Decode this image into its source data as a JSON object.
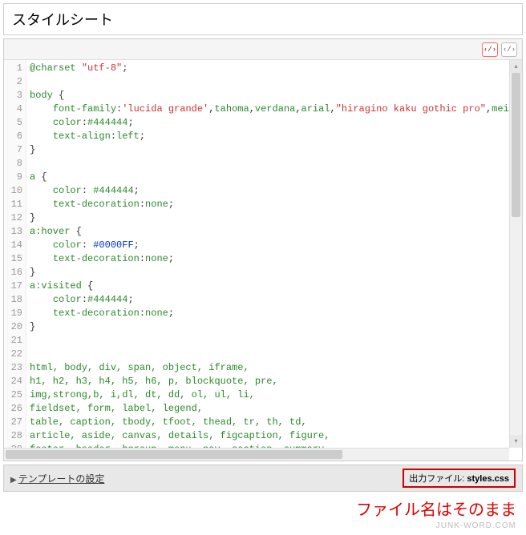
{
  "title": "スタイルシート",
  "toolbar": {
    "btn_wrap_active": "‹/›",
    "btn_wrap_inactive": "‹/›"
  },
  "code": {
    "lines": [
      {
        "n": 1,
        "html": "<span class='t-id'>@charset</span> <span class='t-str'>\"utf-8\"</span>;"
      },
      {
        "n": 2,
        "html": ""
      },
      {
        "n": 3,
        "html": "<span class='t-kw'>body</span> {"
      },
      {
        "n": 4,
        "html": "    <span class='t-prop'>font-family</span>:<span class='t-str'>'lucida grande'</span>,<span class='t-id'>tahoma</span>,<span class='t-id'>verdana</span>,<span class='t-id'>arial</span>,<span class='t-str'>\"hiragino kaku gothic pro\"</span>,<span class='t-id'>meiryo</span>,<span class='t-id'>Osaka</span>,<span class='t-str'>\"ms pgothic\"</span>,s"
      },
      {
        "n": 5,
        "html": "    <span class='t-prop'>color</span>:<span class='t-hex'>#444444</span>;"
      },
      {
        "n": 6,
        "html": "    <span class='t-prop'>text-align</span>:<span class='t-val'>left</span>;"
      },
      {
        "n": 7,
        "html": "}"
      },
      {
        "n": 8,
        "html": ""
      },
      {
        "n": 9,
        "html": "<span class='t-kw'>a</span> {"
      },
      {
        "n": 10,
        "html": "    <span class='t-prop'>color</span>: <span class='t-hex'>#444444</span>;"
      },
      {
        "n": 11,
        "html": "    <span class='t-prop'>text-decoration</span>:<span class='t-val'>none</span>;"
      },
      {
        "n": 12,
        "html": "}"
      },
      {
        "n": 13,
        "html": "<span class='t-kw'>a:hover</span> {"
      },
      {
        "n": 14,
        "html": "    <span class='t-prop'>color</span>: <span class='t-blue'>#0000FF</span>;"
      },
      {
        "n": 15,
        "html": "    <span class='t-prop'>text-decoration</span>:<span class='t-val'>none</span>;"
      },
      {
        "n": 16,
        "html": "}"
      },
      {
        "n": 17,
        "html": "<span class='t-kw'>a:visited</span> {"
      },
      {
        "n": 18,
        "html": "    <span class='t-prop'>color</span>:<span class='t-hex'>#444444</span>;"
      },
      {
        "n": 19,
        "html": "    <span class='t-prop'>text-decoration</span>:<span class='t-val'>none</span>;"
      },
      {
        "n": 20,
        "html": "}"
      },
      {
        "n": 21,
        "html": ""
      },
      {
        "n": 22,
        "html": ""
      },
      {
        "n": 23,
        "html": "<span class='t-kw'>html, body, div, span, object, iframe,</span>"
      },
      {
        "n": 24,
        "html": "<span class='t-kw'>h1, h2, h3, h4, h5, h6, p, blockquote, pre,</span>"
      },
      {
        "n": 25,
        "html": "<span class='t-kw'>img,strong,b, i,dl, dt, dd, ol, ul, li,</span>"
      },
      {
        "n": 26,
        "html": "<span class='t-kw'>fieldset, form, label, legend,</span>"
      },
      {
        "n": 27,
        "html": "<span class='t-kw'>table, caption, tbody, tfoot, thead, tr, th, td,</span>"
      },
      {
        "n": 28,
        "html": "<span class='t-kw'>article, aside, canvas, details, figcaption, figure,</span>"
      },
      {
        "n": 29,
        "html": "<span class='t-kw'>footer, header, hgroup, menu, nav, section, summary,</span>"
      }
    ]
  },
  "footer": {
    "link": "テンプレートの設定",
    "output_label": "出力ファイル:",
    "output_file": "styles.css"
  },
  "annotation": "ファイル名はそのまま",
  "watermark": "JUNK-WORD.COM"
}
